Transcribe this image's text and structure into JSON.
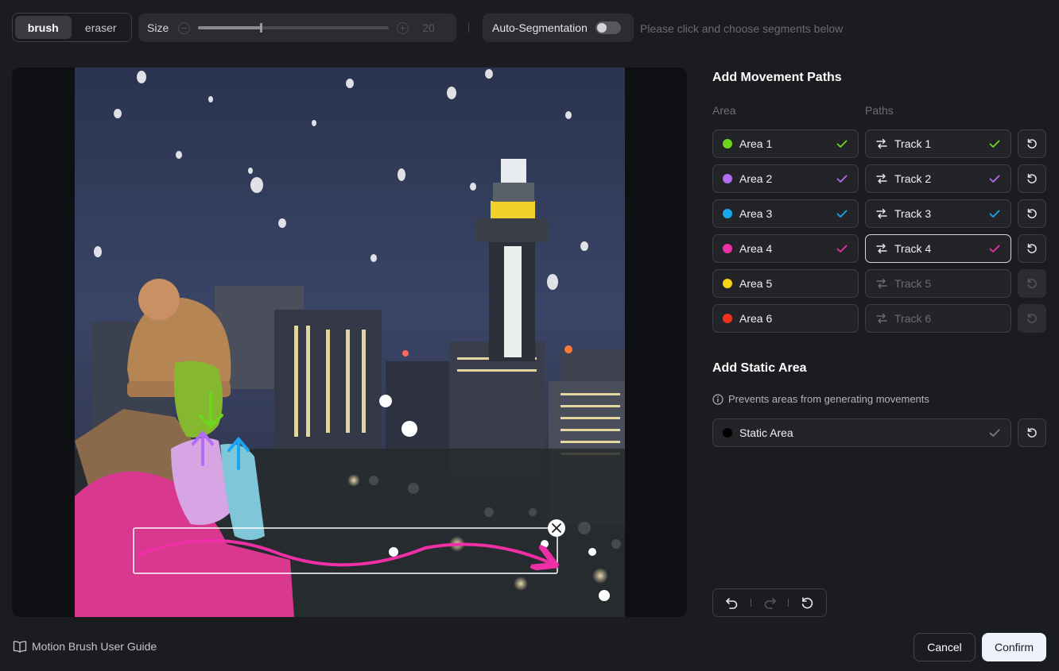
{
  "toolbar": {
    "modes": [
      {
        "label": "brush",
        "active": true
      },
      {
        "label": "eraser",
        "active": false
      }
    ],
    "size_label": "Size",
    "size_value": "20",
    "size_fraction": 0.33,
    "autoseg_label": "Auto-Segmentation",
    "autoseg_on": false,
    "autoseg_hint": "Please click and choose segments below"
  },
  "movement": {
    "title": "Add Movement Paths",
    "area_col_label": "Area",
    "paths_col_label": "Paths",
    "rows": [
      {
        "area": "Area 1",
        "track": "Track 1",
        "color": "#6fd61f",
        "done": true,
        "selected": false
      },
      {
        "area": "Area 2",
        "track": "Track 2",
        "color": "#b36cf5",
        "done": true,
        "selected": false
      },
      {
        "area": "Area 3",
        "track": "Track 3",
        "color": "#1aa7f0",
        "done": true,
        "selected": false
      },
      {
        "area": "Area 4",
        "track": "Track 4",
        "color": "#ee2fa6",
        "done": true,
        "selected": true
      },
      {
        "area": "Area 5",
        "track": "Track 5",
        "color": "#f5d31a",
        "done": false,
        "selected": false
      },
      {
        "area": "Area 6",
        "track": "Track 6",
        "color": "#f03220",
        "done": false,
        "selected": false
      }
    ]
  },
  "static": {
    "title": "Add Static Area",
    "info": "Prevents areas from generating movements",
    "label": "Static Area",
    "color": "#000000"
  },
  "footer": {
    "guide": "Motion Brush User Guide",
    "cancel": "Cancel",
    "confirm": "Confirm"
  },
  "icons": {
    "undo": "undo-icon",
    "redo": "redo-icon",
    "reset": "reset-icon",
    "guide": "book-icon",
    "info": "info-icon",
    "path": "path-icon",
    "check": "check-icon",
    "close": "close-icon"
  }
}
